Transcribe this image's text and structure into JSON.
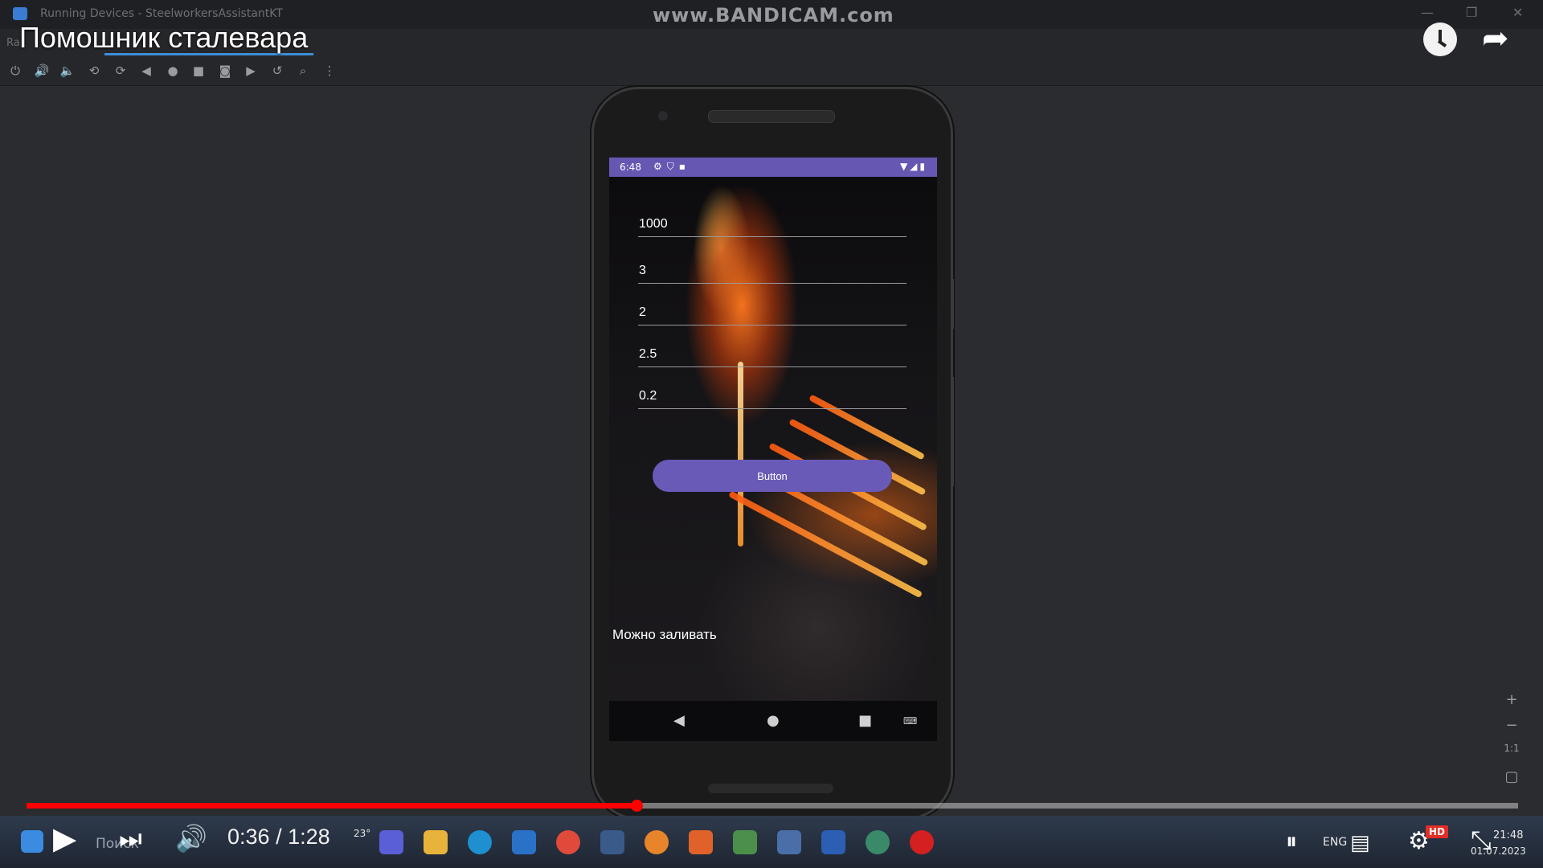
{
  "ide": {
    "window_title": "Running Devices - SteelworkersAssistantKT",
    "tab_label": "Ra",
    "watermark": "www.BANDICAM.com",
    "toolbar_icons": [
      "power-icon",
      "volume-up-icon",
      "volume-down-icon",
      "rotate-left-icon",
      "rotate-right-icon",
      "back-icon",
      "home-icon",
      "overview-icon",
      "screenshot-icon",
      "record-icon",
      "reset-icon",
      "zoom-icon",
      "more-icon"
    ]
  },
  "video": {
    "title": "Помошник сталевара",
    "current_time": "0:36",
    "separator": " / ",
    "duration": "1:28",
    "progress": 0.409
  },
  "phone": {
    "status_time": "6:48",
    "fields": [
      {
        "value": "1000"
      },
      {
        "value": "3"
      },
      {
        "value": "2"
      },
      {
        "value": "2.5"
      },
      {
        "value": "0.2"
      }
    ],
    "button_label": "Button",
    "result_text": "Можно заливать"
  },
  "zoom_tools": {
    "zoom_in": "+",
    "zoom_out": "−",
    "actual_size": "1:1"
  },
  "taskbar": {
    "search_label": "Поиск",
    "weather_temp": "23°",
    "language": "ENG",
    "clock_time": "21:48",
    "clock_date": "01.07.2023",
    "hd_label": "HD"
  },
  "colors": {
    "status_bar": "#6657b3",
    "button": "#6a5ab8",
    "progress": "#ff0000"
  }
}
